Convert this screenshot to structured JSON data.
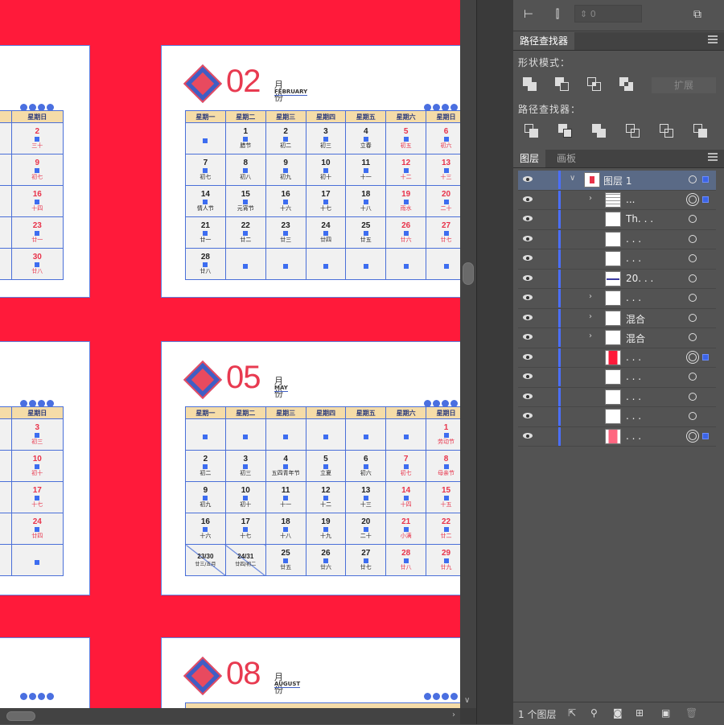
{
  "canvas": {
    "background": "#ff1a3a",
    "calendars": [
      {
        "month_number": "02",
        "month_label": "月份",
        "month_english": "FEBRUARY",
        "weekdays": [
          "星期一",
          "星期二",
          "星期三",
          "星期四",
          "星期五",
          "星期六",
          "星期日"
        ],
        "rows": [
          [
            {
              "d": "",
              "l": ""
            },
            {
              "d": "1",
              "l": "腊节"
            },
            {
              "d": "2",
              "l": "初二"
            },
            {
              "d": "3",
              "l": "初三"
            },
            {
              "d": "4",
              "l": "立春"
            },
            {
              "d": "5",
              "l": "初五",
              "red": true
            },
            {
              "d": "6",
              "l": "初六",
              "red": true
            }
          ],
          [
            {
              "d": "7",
              "l": "初七"
            },
            {
              "d": "8",
              "l": "初八"
            },
            {
              "d": "9",
              "l": "初九"
            },
            {
              "d": "10",
              "l": "初十"
            },
            {
              "d": "11",
              "l": "十一"
            },
            {
              "d": "12",
              "l": "十二",
              "red": true
            },
            {
              "d": "13",
              "l": "十三",
              "red": true
            }
          ],
          [
            {
              "d": "14",
              "l": "情人节"
            },
            {
              "d": "15",
              "l": "元宵节"
            },
            {
              "d": "16",
              "l": "十六"
            },
            {
              "d": "17",
              "l": "十七"
            },
            {
              "d": "18",
              "l": "十八"
            },
            {
              "d": "19",
              "l": "雨水",
              "red": true
            },
            {
              "d": "20",
              "l": "二十",
              "red": true
            }
          ],
          [
            {
              "d": "21",
              "l": "廿一"
            },
            {
              "d": "22",
              "l": "廿二"
            },
            {
              "d": "23",
              "l": "廿三"
            },
            {
              "d": "24",
              "l": "廿四"
            },
            {
              "d": "25",
              "l": "廿五"
            },
            {
              "d": "26",
              "l": "廿六",
              "red": true
            },
            {
              "d": "27",
              "l": "廿七",
              "red": true
            }
          ],
          [
            {
              "d": "28",
              "l": "廿八"
            },
            {
              "d": "",
              "l": ""
            },
            {
              "d": "",
              "l": ""
            },
            {
              "d": "",
              "l": ""
            },
            {
              "d": "",
              "l": ""
            },
            {
              "d": "",
              "l": ""
            },
            {
              "d": "",
              "l": ""
            }
          ]
        ]
      },
      {
        "month_number": "05",
        "month_label": "月份",
        "month_english": "MAY",
        "weekdays": [
          "星期一",
          "星期二",
          "星期三",
          "星期四",
          "星期五",
          "星期六",
          "星期日"
        ],
        "rows": [
          [
            {
              "d": "",
              "l": ""
            },
            {
              "d": "",
              "l": ""
            },
            {
              "d": "",
              "l": ""
            },
            {
              "d": "",
              "l": ""
            },
            {
              "d": "",
              "l": ""
            },
            {
              "d": "",
              "l": ""
            },
            {
              "d": "1",
              "l": "劳动节",
              "red": true
            }
          ],
          [
            {
              "d": "2",
              "l": "初二"
            },
            {
              "d": "3",
              "l": "初三"
            },
            {
              "d": "4",
              "l": "五四青年节"
            },
            {
              "d": "5",
              "l": "立夏"
            },
            {
              "d": "6",
              "l": "初六"
            },
            {
              "d": "7",
              "l": "初七",
              "red": true
            },
            {
              "d": "8",
              "l": "母亲节",
              "red": true
            }
          ],
          [
            {
              "d": "9",
              "l": "初九"
            },
            {
              "d": "10",
              "l": "初十"
            },
            {
              "d": "11",
              "l": "十一"
            },
            {
              "d": "12",
              "l": "十二"
            },
            {
              "d": "13",
              "l": "十三"
            },
            {
              "d": "14",
              "l": "十四",
              "red": true
            },
            {
              "d": "15",
              "l": "十五",
              "red": true
            }
          ],
          [
            {
              "d": "16",
              "l": "十六"
            },
            {
              "d": "17",
              "l": "十七"
            },
            {
              "d": "18",
              "l": "十八"
            },
            {
              "d": "19",
              "l": "十九"
            },
            {
              "d": "20",
              "l": "二十"
            },
            {
              "d": "21",
              "l": "小满",
              "red": true
            },
            {
              "d": "22",
              "l": "廿二",
              "red": true
            }
          ],
          [
            {
              "d": "23/30",
              "l": "廿三/五月",
              "split": true
            },
            {
              "d": "24/31",
              "l": "廿四/初二",
              "split": true
            },
            {
              "d": "25",
              "l": "廿五"
            },
            {
              "d": "26",
              "l": "廿六"
            },
            {
              "d": "27",
              "l": "廿七"
            },
            {
              "d": "28",
              "l": "廿八",
              "red": true
            },
            {
              "d": "29",
              "l": "廿九",
              "red": true
            }
          ]
        ]
      },
      {
        "month_number": "08",
        "month_label": "月份",
        "month_english": "AUGUST"
      }
    ],
    "left_partial_columns": {
      "header_top": [
        "期六",
        "星期日"
      ],
      "rows_top": [
        [
          {
            "d": "1",
            "l": "-"
          },
          {
            "d": "2",
            "l": "三十"
          }
        ],
        [
          {
            "d": "8",
            "l": "-"
          },
          {
            "d": "9",
            "l": "初七"
          }
        ],
        [
          {
            "d": "15",
            "l": "-"
          },
          {
            "d": "16",
            "l": "十四"
          }
        ],
        [
          {
            "d": "22",
            "l": "-"
          },
          {
            "d": "23",
            "l": "廿一"
          }
        ],
        [
          {
            "d": "29",
            "l": "-"
          },
          {
            "d": "30",
            "l": "廿八"
          }
        ]
      ],
      "header_mid": [
        "期六",
        "星期日"
      ],
      "rows_mid": [
        [
          {
            "d": "2",
            "l": "-"
          },
          {
            "d": "3",
            "l": "初三"
          }
        ],
        [
          {
            "d": "9",
            "l": "-"
          },
          {
            "d": "10",
            "l": "初十"
          }
        ],
        [
          {
            "d": "16",
            "l": "-"
          },
          {
            "d": "17",
            "l": "十七"
          }
        ],
        [
          {
            "d": "23",
            "l": "-"
          },
          {
            "d": "24",
            "l": "廿四"
          }
        ],
        [
          {
            "d": "30",
            "l": "-"
          },
          {
            "d": "",
            "l": ""
          }
        ]
      ]
    }
  },
  "toolbar": {
    "stroke_value": "0"
  },
  "pathfinder": {
    "tab_label": "路径查找器",
    "shape_modes_label": "形状模式：",
    "expand_label": "扩展",
    "pathfinders_label": "路径查找器："
  },
  "layers_panel": {
    "tabs": [
      "图层",
      "画板"
    ],
    "rows": [
      {
        "name": "图层 1",
        "indent": 0,
        "chevron": "open",
        "selected": true,
        "circle": "single",
        "sel_square": true
      },
      {
        "name": "...",
        "indent": 1,
        "chevron": "closed",
        "circle": "double",
        "sel_square": true,
        "thumb": "grid"
      },
      {
        "name": "Th. . .",
        "indent": 1,
        "chevron": "",
        "circle": "single"
      },
      {
        "name": ". . .",
        "indent": 1,
        "chevron": "",
        "circle": "single"
      },
      {
        "name": ". . .",
        "indent": 1,
        "chevron": "",
        "circle": "single"
      },
      {
        "name": "20. . .",
        "indent": 1,
        "chevron": "",
        "circle": "single",
        "thumb": "line"
      },
      {
        "name": ". . .",
        "indent": 1,
        "chevron": "closed",
        "circle": "single"
      },
      {
        "name": "混合",
        "indent": 1,
        "chevron": "closed",
        "circle": "single"
      },
      {
        "name": "混合",
        "indent": 1,
        "chevron": "closed",
        "circle": "single"
      },
      {
        "name": ". . .",
        "indent": 1,
        "chevron": "",
        "circle": "double",
        "sel_square": true,
        "thumb": "red"
      },
      {
        "name": ". . .",
        "indent": 1,
        "chevron": "",
        "circle": "single"
      },
      {
        "name": ". . .",
        "indent": 1,
        "chevron": "",
        "circle": "single"
      },
      {
        "name": ". . .",
        "indent": 1,
        "chevron": "",
        "circle": "single"
      },
      {
        "name": ". . .",
        "indent": 1,
        "chevron": "",
        "circle": "double",
        "sel_square": true,
        "thumb": "pink"
      }
    ],
    "footer_label": "1 个图层"
  }
}
